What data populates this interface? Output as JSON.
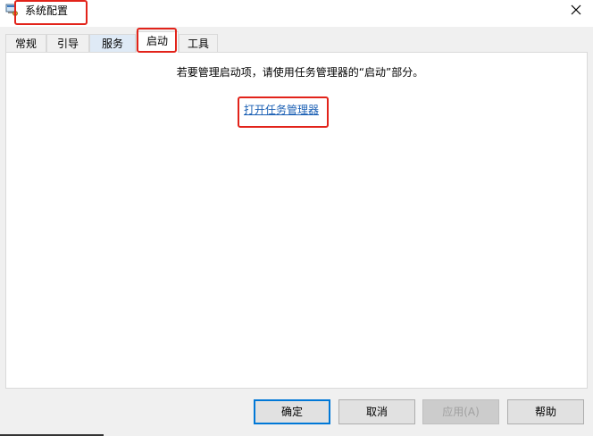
{
  "window": {
    "title": "系统配置",
    "close_glyph": "×"
  },
  "tabs": [
    {
      "label": "常规"
    },
    {
      "label": "引导"
    },
    {
      "label": "服务"
    },
    {
      "label": "启动",
      "selected": true
    },
    {
      "label": "工具"
    }
  ],
  "startup_panel": {
    "message": "若要管理启动项，请使用任务管理器的“启动”部分。",
    "link_text": "打开任务管理器"
  },
  "buttons": {
    "ok": "确定",
    "cancel": "取消",
    "apply": "应用(A)",
    "help": "帮助"
  },
  "colors": {
    "accent": "#0078d7",
    "highlight": "#e2231a",
    "link": "#1a5fb4"
  },
  "icons": {
    "app": "msconfig-icon",
    "close": "close-icon"
  }
}
